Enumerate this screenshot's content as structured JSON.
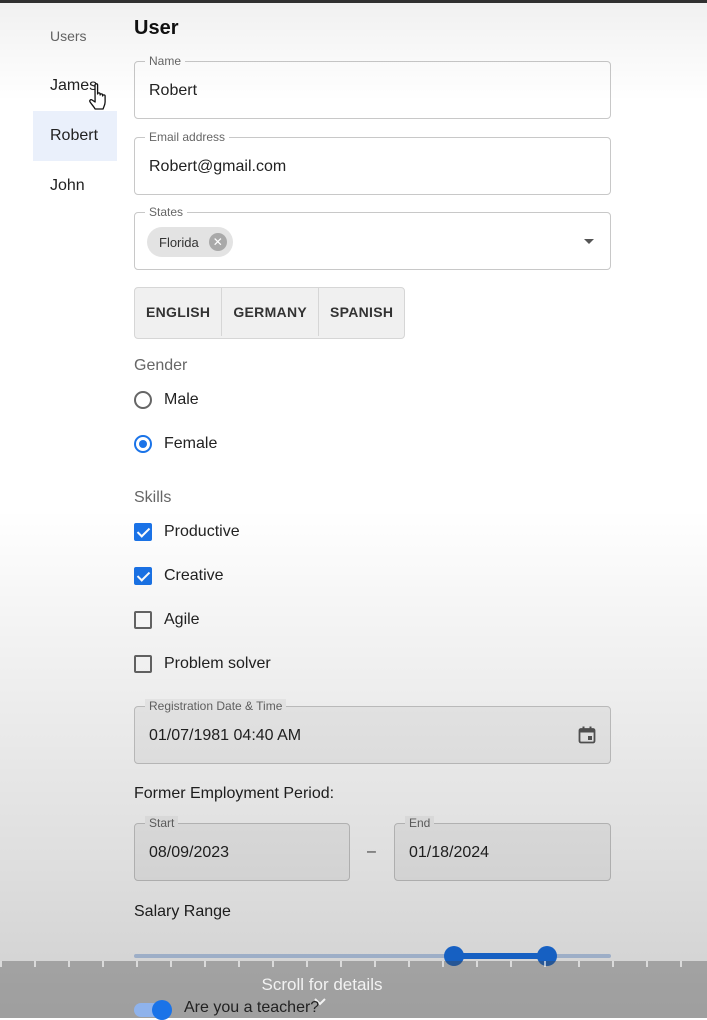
{
  "sidebar": {
    "header": "Users",
    "items": [
      {
        "label": "James"
      },
      {
        "label": "Robert"
      },
      {
        "label": "John"
      }
    ],
    "selected_index": 1
  },
  "form": {
    "title": "User",
    "name": {
      "label": "Name",
      "value": "Robert"
    },
    "email": {
      "label": "Email address",
      "value": "Robert@gmail.com"
    },
    "states": {
      "label": "States",
      "chips": [
        "Florida"
      ]
    },
    "languages": [
      "ENGLISH",
      "GERMANY",
      "SPANISH"
    ],
    "gender": {
      "label": "Gender",
      "options": [
        "Male",
        "Female"
      ],
      "selected": "Female"
    },
    "skills": {
      "label": "Skills",
      "options": [
        {
          "label": "Productive",
          "checked": true
        },
        {
          "label": "Creative",
          "checked": true
        },
        {
          "label": "Agile",
          "checked": false
        },
        {
          "label": "Problem solver",
          "checked": false
        }
      ]
    },
    "registration": {
      "label": "Registration Date & Time",
      "value": "01/07/1981 04:40 AM",
      "icon": "calendar-icon"
    },
    "employment": {
      "label": "Former Employment Period:",
      "start": {
        "label": "Start",
        "value": "08/09/2023"
      },
      "separator": "–",
      "end": {
        "label": "End",
        "value": "01/18/2024"
      }
    },
    "salary": {
      "label": "Salary Range",
      "range_fraction": [
        0.67,
        0.865
      ]
    },
    "teacher": {
      "label": "Are you a teacher?",
      "on": true
    }
  },
  "overlay": {
    "scroll_text": "Scroll for details"
  },
  "colors": {
    "accent": "#1a73e8",
    "selected_bg": "#eaf0fb"
  }
}
